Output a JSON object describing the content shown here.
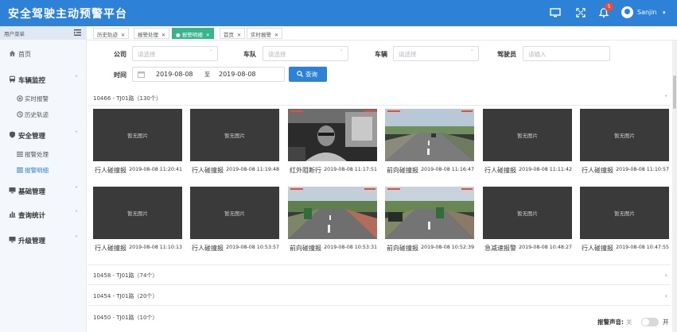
{
  "header": {
    "title": "安全驾驶主动预警平台",
    "notification_count": "5",
    "username": "Sanjin",
    "accent": "#2d82d8"
  },
  "sidebar": {
    "heading": "用户菜单",
    "items": [
      {
        "label": "首页",
        "icon": "home-icon",
        "kind": "top"
      },
      {
        "label": "车辆监控",
        "icon": "bus-icon",
        "kind": "group"
      },
      {
        "label": "实时报警",
        "icon": "target-icon",
        "kind": "sub"
      },
      {
        "label": "历史轨迹",
        "icon": "history-icon",
        "kind": "sub"
      },
      {
        "label": "安全管理",
        "icon": "shield-icon",
        "kind": "group"
      },
      {
        "label": "报警处理",
        "icon": "list-icon",
        "kind": "sub"
      },
      {
        "label": "报警明细",
        "icon": "list-icon",
        "kind": "sub",
        "active": true
      },
      {
        "label": "基础管理",
        "icon": "monitor-icon",
        "kind": "group"
      },
      {
        "label": "查询统计",
        "icon": "bar-chart-icon",
        "kind": "group"
      },
      {
        "label": "升级管理",
        "icon": "monitor-icon",
        "kind": "group"
      }
    ]
  },
  "tabs": [
    {
      "label": "历史轨迹"
    },
    {
      "label": "报警处理"
    },
    {
      "label": "报警明细",
      "active": true
    },
    {
      "label": "首页"
    },
    {
      "label": "实时报警"
    }
  ],
  "filters": {
    "company_label": "公司",
    "company_placeholder": "请选择",
    "team_label": "车队",
    "team_placeholder": "请选择",
    "vehicle_label": "车辆",
    "vehicle_placeholder": "请选择",
    "driver_label": "驾驶员",
    "driver_placeholder": "请输入",
    "time_label": "时间",
    "date_from": "2019-08-08",
    "date_sep": "至",
    "date_to": "2019-08-08",
    "query_button": "查询"
  },
  "groups": [
    {
      "title": "10466 - TJ01路（130个）",
      "expanded": true
    },
    {
      "title": "10458 - TJ01路（74个）",
      "expanded": false
    },
    {
      "title": "10454 - TJ01路（20个）",
      "expanded": false
    },
    {
      "title": "10450 - TJ01路（10个）",
      "expanded": false
    }
  ],
  "no_image_text": "暂无图片",
  "alarms": [
    {
      "type": "行人碰撞报",
      "time": "2019-08-08 11:20:41",
      "image": "none"
    },
    {
      "type": "行人碰撞报",
      "time": "2019-08-08 11:19:48",
      "image": "none"
    },
    {
      "type": "红外阻断行",
      "time": "2019-08-08 11:17:51",
      "image": "cabin"
    },
    {
      "type": "前向碰撞报",
      "time": "2019-08-08 11:16:47",
      "image": "road"
    },
    {
      "type": "行人碰撞报",
      "time": "2019-08-08 11:11:42",
      "image": "none"
    },
    {
      "type": "行人碰撞报",
      "time": "2019-08-08 11:10:57",
      "image": "none"
    },
    {
      "type": "行人碰撞报",
      "time": "2019-08-08 11:10:13",
      "image": "none"
    },
    {
      "type": "行人碰撞报",
      "time": "2019-08-08 10:53:57",
      "image": "none"
    },
    {
      "type": "前向碰撞报",
      "time": "2019-08-08 10:53:31",
      "image": "road"
    },
    {
      "type": "前向碰撞报",
      "time": "2019-08-08 10:52:39",
      "image": "road"
    },
    {
      "type": "急减速报警",
      "time": "2019-08-08 10:48:27",
      "image": "none"
    },
    {
      "type": "行人碰撞报",
      "time": "2019-08-08 10:47:55",
      "image": "none"
    }
  ],
  "sound": {
    "label": "报警声音:",
    "off": "关",
    "on": "开",
    "enabled": false
  }
}
